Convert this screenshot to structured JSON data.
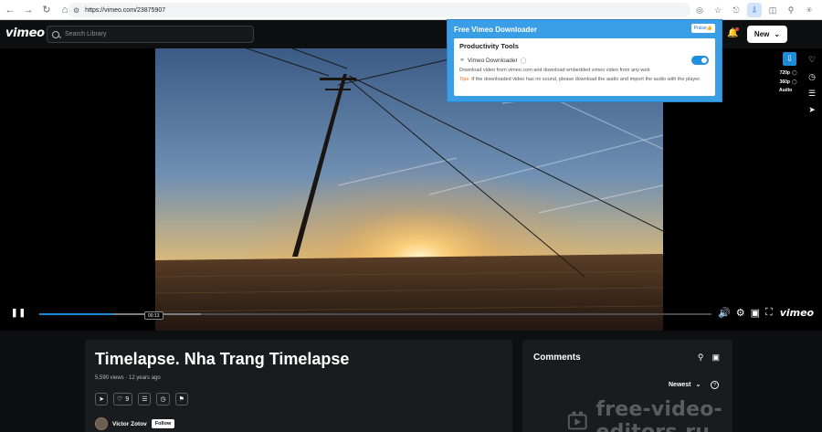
{
  "browser": {
    "url": "https://vimeo.com/23875907",
    "back_icon": "arrow-left-icon",
    "forward_icon": "arrow-right-icon"
  },
  "header": {
    "logo": "vimeo",
    "search_placeholder": "Search Library",
    "new_button": "New"
  },
  "extension_popup": {
    "title": "Free Vimeo Downloader",
    "praise_label": "Praise👍",
    "section_title": "Productivity Tools",
    "tool_name": "Vimeo Downloader",
    "toggle_on": true,
    "description": "Download video from vimeo.com and download embedded vimeo video from any web",
    "tips_label": "Tips:",
    "tips_text": " If the downloaded video has no sound, please download the audio and import the audio with the player."
  },
  "player": {
    "time_bubble": "00:13",
    "progress_played": 0.11,
    "progress_buffered": 0.24,
    "qualities": [
      "720p",
      "360p",
      "Audio"
    ],
    "control_logo": "vimeo"
  },
  "video_info": {
    "title": "Timelapse. Nha Trang Timelapse",
    "views": "5,590 views",
    "age": "12 years ago",
    "likes": "9",
    "author": "Victor Zotov",
    "follow_label": "Follow"
  },
  "comments": {
    "title": "Comments",
    "sort_label": "Newest",
    "help": "?"
  },
  "watermark": {
    "text": "free-video-editors.ru"
  }
}
